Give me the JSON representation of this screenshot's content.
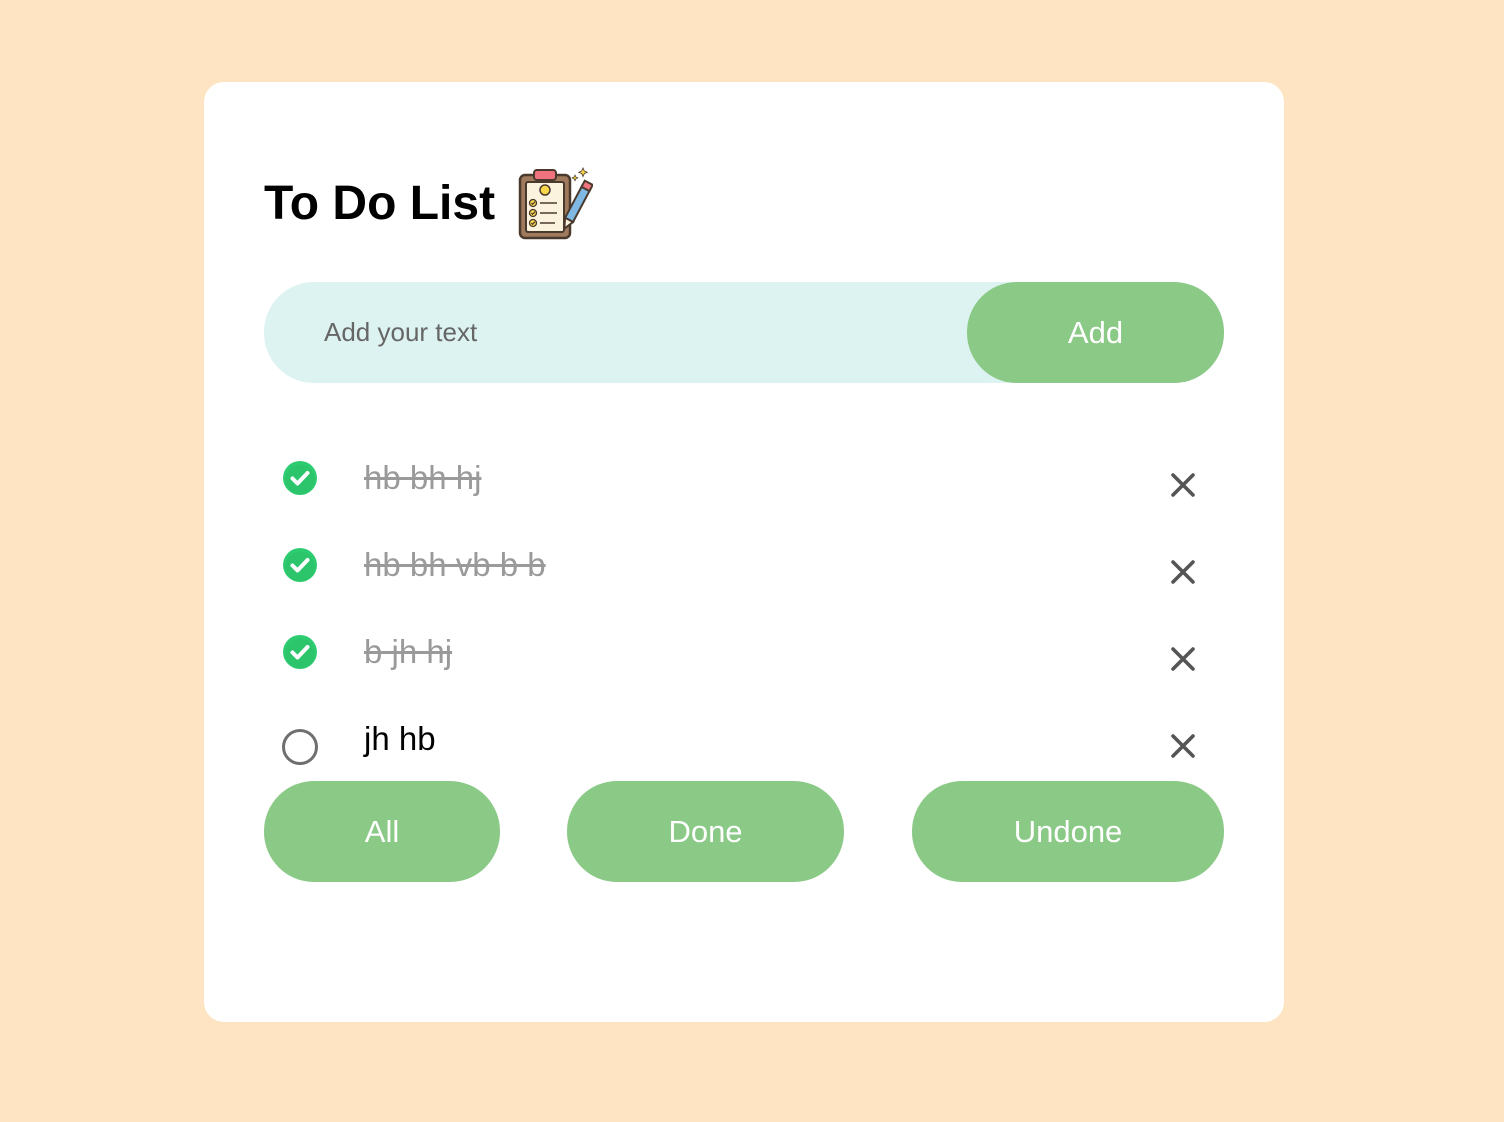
{
  "header": {
    "title": "To Do List",
    "icon": "clipboard-checklist-icon"
  },
  "input": {
    "placeholder": "Add your text",
    "value": ""
  },
  "add_button": {
    "label": "Add"
  },
  "todos": [
    {
      "text": "hb bh hj",
      "done": true
    },
    {
      "text": "hb bh vb b b",
      "done": true
    },
    {
      "text": "b jh hj",
      "done": true
    },
    {
      "text": "jh hb",
      "done": false
    }
  ],
  "filters": {
    "all": "All",
    "done": "Done",
    "undone": "Undone"
  },
  "colors": {
    "page_background": "#FEE4C3",
    "card_background": "#FFFFFF",
    "input_background": "#DDF3F1",
    "button_green": "#8BC987",
    "check_green": "#2ECC71",
    "done_text": "#9A9A9A",
    "delete_icon": "#555555"
  }
}
